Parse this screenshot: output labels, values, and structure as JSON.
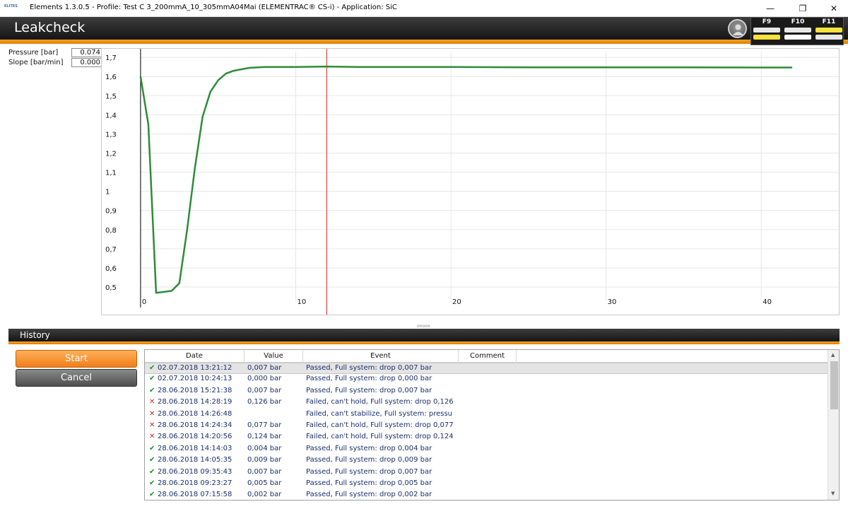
{
  "window": {
    "title": "Elements 1.3.0.5 - Profile: Test C 3_200mmA_10_305mmA04Mai (ELEMENTRAC® CS-i) - Application: SiC",
    "app_icon_text": "ELITES",
    "controls": {
      "minimize": "—",
      "restore": "❐",
      "close": "✕"
    }
  },
  "header": {
    "title": "Leakcheck"
  },
  "fkeys": [
    {
      "label": "F9",
      "top_color": "#e8e8e8",
      "bottom_color": "#f5e23a"
    },
    {
      "label": "F10",
      "top_color": "#e8e8e8",
      "bottom_color": "#ffffff"
    },
    {
      "label": "F11",
      "top_color": "#f5e23a",
      "bottom_color": "#e8e8e8"
    }
  ],
  "readouts": {
    "pressure_label": "Pressure [bar]",
    "pressure_value": "0.074",
    "slope_label": "Slope [bar/min]",
    "slope_value": "0.000"
  },
  "chart_data": {
    "type": "line",
    "title": "",
    "xlabel": "",
    "ylabel": "",
    "xlim": [
      -2.5,
      45
    ],
    "ylim": [
      0.43,
      1.73
    ],
    "x_ticks": [
      "0",
      "10",
      "20",
      "30",
      "40"
    ],
    "x_tick_values": [
      0,
      10,
      20,
      30,
      40
    ],
    "y_ticks": [
      "1,7",
      "1,6",
      "1,5",
      "1,4",
      "1,3",
      "1,2",
      "1,1",
      "1",
      "0,9",
      "0,8",
      "0,7",
      "0,6",
      "0,5"
    ],
    "y_tick_values": [
      1.7,
      1.6,
      1.5,
      1.4,
      1.3,
      1.2,
      1.1,
      1.0,
      0.9,
      0.8,
      0.7,
      0.6,
      0.5
    ],
    "grid": true,
    "cursor_x": 12,
    "series": [
      {
        "color": "#2e8b3a",
        "x": [
          0,
          0.5,
          1,
          2,
          2.5,
          3,
          3.5,
          4,
          4.5,
          5,
          5.5,
          6,
          7,
          8,
          10,
          12,
          14,
          20,
          25,
          30,
          35,
          40,
          42
        ],
        "y": [
          1.6,
          1.35,
          0.47,
          0.48,
          0.52,
          0.8,
          1.12,
          1.39,
          1.52,
          1.58,
          1.615,
          1.63,
          1.645,
          1.65,
          1.65,
          1.652,
          1.65,
          1.65,
          1.648,
          1.648,
          1.648,
          1.647,
          1.647
        ]
      }
    ]
  },
  "history": {
    "title": "History",
    "start_label": "Start",
    "cancel_label": "Cancel",
    "columns": [
      "Date",
      "Value",
      "Event",
      "Comment"
    ],
    "rows": [
      {
        "status": "pass",
        "date": "02.07.2018 13:21:12",
        "value": "0,007 bar",
        "event": "Passed, Full system: drop 0,007 bar",
        "comment": ""
      },
      {
        "status": "pass",
        "date": "02.07.2018 10:24:13",
        "value": "0,000 bar",
        "event": "Passed, Full system: drop 0,000 bar",
        "comment": ""
      },
      {
        "status": "pass",
        "date": "28.06.2018 15:21:38",
        "value": "0,007 bar",
        "event": "Passed, Full system: drop 0,007 bar",
        "comment": ""
      },
      {
        "status": "fail",
        "date": "28.06.2018 14:28:19",
        "value": "0,126 bar",
        "event": "Failed, can't hold, Full system: drop 0,126",
        "comment": ""
      },
      {
        "status": "fail",
        "date": "28.06.2018 14:26:48",
        "value": "",
        "event": "Failed, can't stabilize, Full system: pressu",
        "comment": ""
      },
      {
        "status": "fail",
        "date": "28.06.2018 14:24:34",
        "value": "0,077 bar",
        "event": "Failed, can't hold, Full system: drop 0,077",
        "comment": ""
      },
      {
        "status": "fail",
        "date": "28.06.2018 14:20:56",
        "value": "0,124 bar",
        "event": "Failed, can't hold, Full system: drop 0,124",
        "comment": ""
      },
      {
        "status": "pass",
        "date": "28.06.2018 14:14:03",
        "value": "0,004 bar",
        "event": "Passed, Full system: drop 0,004 bar",
        "comment": ""
      },
      {
        "status": "pass",
        "date": "28.06.2018 14:05:35",
        "value": "0,009 bar",
        "event": "Passed, Full system: drop 0,009 bar",
        "comment": ""
      },
      {
        "status": "pass",
        "date": "28.06.2018 09:35:43",
        "value": "0,007 bar",
        "event": "Passed, Full system: drop 0,007 bar",
        "comment": ""
      },
      {
        "status": "pass",
        "date": "28.06.2018 09:23:27",
        "value": "0,005 bar",
        "event": "Passed, Full system: drop 0,005 bar",
        "comment": ""
      },
      {
        "status": "pass",
        "date": "28.06.2018 07:15:58",
        "value": "0,002 bar",
        "event": "Passed, Full system: drop 0,002 bar",
        "comment": ""
      }
    ]
  },
  "icons": {
    "pass": "✔",
    "fail": "✕",
    "scroll_up": "▲",
    "scroll_down": "▼",
    "splitter": "ooooo"
  }
}
